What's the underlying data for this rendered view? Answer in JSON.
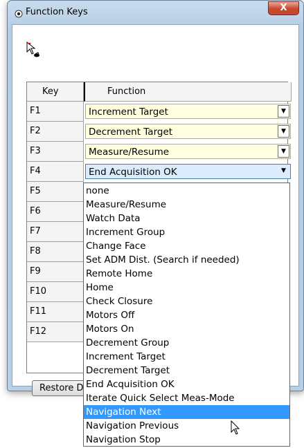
{
  "window": {
    "title": "Function Keys",
    "close_label": "X"
  },
  "grid": {
    "headers": {
      "key": "Key",
      "function": "Function"
    },
    "rows": [
      {
        "key": "F1",
        "function": "Increment Target"
      },
      {
        "key": "F2",
        "function": "Decrement Target"
      },
      {
        "key": "F3",
        "function": "Measure/Resume"
      },
      {
        "key": "F4",
        "function": "End Acquisition OK"
      },
      {
        "key": "F5",
        "function": ""
      },
      {
        "key": "F6",
        "function": ""
      },
      {
        "key": "F7",
        "function": ""
      },
      {
        "key": "F8",
        "function": ""
      },
      {
        "key": "F9",
        "function": ""
      },
      {
        "key": "F10",
        "function": ""
      },
      {
        "key": "F11",
        "function": ""
      },
      {
        "key": "F12",
        "function": ""
      }
    ]
  },
  "buttons": {
    "restore": "Restore Defaults"
  },
  "dropdown": {
    "selected_index": 16,
    "options": [
      "none",
      "Measure/Resume",
      "Watch Data",
      "Increment Group",
      "Change Face",
      "Set ADM Dist. (Search if needed)",
      "Remote Home",
      "Home",
      "Check Closure",
      "Motors Off",
      "Motors On",
      "Decrement Group",
      "Increment Target",
      "Decrement Target",
      "End Acquisition OK",
      "Iterate Quick Select Meas-Mode",
      "Navigation Next",
      "Navigation Previous",
      "Navigation Stop"
    ]
  },
  "colors": {
    "combo_bg": "#ffffe0",
    "highlight": "#3399ff",
    "close_button": "#c9462c"
  }
}
